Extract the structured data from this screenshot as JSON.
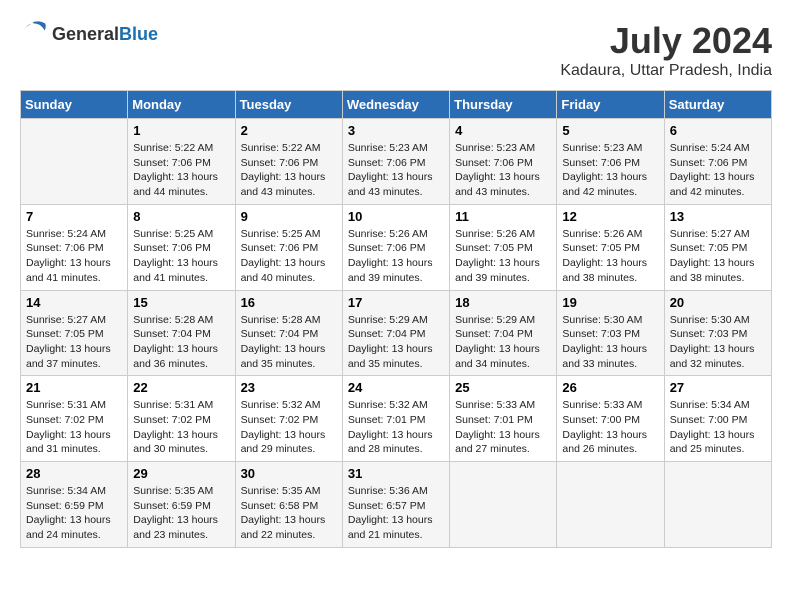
{
  "logo": {
    "text_general": "General",
    "text_blue": "Blue"
  },
  "title": {
    "month_year": "July 2024",
    "location": "Kadaura, Uttar Pradesh, India"
  },
  "days_of_week": [
    "Sunday",
    "Monday",
    "Tuesday",
    "Wednesday",
    "Thursday",
    "Friday",
    "Saturday"
  ],
  "weeks": [
    [
      {
        "day": "",
        "sunrise": "",
        "sunset": "",
        "daylight": ""
      },
      {
        "day": "1",
        "sunrise": "Sunrise: 5:22 AM",
        "sunset": "Sunset: 7:06 PM",
        "daylight": "Daylight: 13 hours and 44 minutes."
      },
      {
        "day": "2",
        "sunrise": "Sunrise: 5:22 AM",
        "sunset": "Sunset: 7:06 PM",
        "daylight": "Daylight: 13 hours and 43 minutes."
      },
      {
        "day": "3",
        "sunrise": "Sunrise: 5:23 AM",
        "sunset": "Sunset: 7:06 PM",
        "daylight": "Daylight: 13 hours and 43 minutes."
      },
      {
        "day": "4",
        "sunrise": "Sunrise: 5:23 AM",
        "sunset": "Sunset: 7:06 PM",
        "daylight": "Daylight: 13 hours and 43 minutes."
      },
      {
        "day": "5",
        "sunrise": "Sunrise: 5:23 AM",
        "sunset": "Sunset: 7:06 PM",
        "daylight": "Daylight: 13 hours and 42 minutes."
      },
      {
        "day": "6",
        "sunrise": "Sunrise: 5:24 AM",
        "sunset": "Sunset: 7:06 PM",
        "daylight": "Daylight: 13 hours and 42 minutes."
      }
    ],
    [
      {
        "day": "7",
        "sunrise": "Sunrise: 5:24 AM",
        "sunset": "Sunset: 7:06 PM",
        "daylight": "Daylight: 13 hours and 41 minutes."
      },
      {
        "day": "8",
        "sunrise": "Sunrise: 5:25 AM",
        "sunset": "Sunset: 7:06 PM",
        "daylight": "Daylight: 13 hours and 41 minutes."
      },
      {
        "day": "9",
        "sunrise": "Sunrise: 5:25 AM",
        "sunset": "Sunset: 7:06 PM",
        "daylight": "Daylight: 13 hours and 40 minutes."
      },
      {
        "day": "10",
        "sunrise": "Sunrise: 5:26 AM",
        "sunset": "Sunset: 7:06 PM",
        "daylight": "Daylight: 13 hours and 39 minutes."
      },
      {
        "day": "11",
        "sunrise": "Sunrise: 5:26 AM",
        "sunset": "Sunset: 7:05 PM",
        "daylight": "Daylight: 13 hours and 39 minutes."
      },
      {
        "day": "12",
        "sunrise": "Sunrise: 5:26 AM",
        "sunset": "Sunset: 7:05 PM",
        "daylight": "Daylight: 13 hours and 38 minutes."
      },
      {
        "day": "13",
        "sunrise": "Sunrise: 5:27 AM",
        "sunset": "Sunset: 7:05 PM",
        "daylight": "Daylight: 13 hours and 38 minutes."
      }
    ],
    [
      {
        "day": "14",
        "sunrise": "Sunrise: 5:27 AM",
        "sunset": "Sunset: 7:05 PM",
        "daylight": "Daylight: 13 hours and 37 minutes."
      },
      {
        "day": "15",
        "sunrise": "Sunrise: 5:28 AM",
        "sunset": "Sunset: 7:04 PM",
        "daylight": "Daylight: 13 hours and 36 minutes."
      },
      {
        "day": "16",
        "sunrise": "Sunrise: 5:28 AM",
        "sunset": "Sunset: 7:04 PM",
        "daylight": "Daylight: 13 hours and 35 minutes."
      },
      {
        "day": "17",
        "sunrise": "Sunrise: 5:29 AM",
        "sunset": "Sunset: 7:04 PM",
        "daylight": "Daylight: 13 hours and 35 minutes."
      },
      {
        "day": "18",
        "sunrise": "Sunrise: 5:29 AM",
        "sunset": "Sunset: 7:04 PM",
        "daylight": "Daylight: 13 hours and 34 minutes."
      },
      {
        "day": "19",
        "sunrise": "Sunrise: 5:30 AM",
        "sunset": "Sunset: 7:03 PM",
        "daylight": "Daylight: 13 hours and 33 minutes."
      },
      {
        "day": "20",
        "sunrise": "Sunrise: 5:30 AM",
        "sunset": "Sunset: 7:03 PM",
        "daylight": "Daylight: 13 hours and 32 minutes."
      }
    ],
    [
      {
        "day": "21",
        "sunrise": "Sunrise: 5:31 AM",
        "sunset": "Sunset: 7:02 PM",
        "daylight": "Daylight: 13 hours and 31 minutes."
      },
      {
        "day": "22",
        "sunrise": "Sunrise: 5:31 AM",
        "sunset": "Sunset: 7:02 PM",
        "daylight": "Daylight: 13 hours and 30 minutes."
      },
      {
        "day": "23",
        "sunrise": "Sunrise: 5:32 AM",
        "sunset": "Sunset: 7:02 PM",
        "daylight": "Daylight: 13 hours and 29 minutes."
      },
      {
        "day": "24",
        "sunrise": "Sunrise: 5:32 AM",
        "sunset": "Sunset: 7:01 PM",
        "daylight": "Daylight: 13 hours and 28 minutes."
      },
      {
        "day": "25",
        "sunrise": "Sunrise: 5:33 AM",
        "sunset": "Sunset: 7:01 PM",
        "daylight": "Daylight: 13 hours and 27 minutes."
      },
      {
        "day": "26",
        "sunrise": "Sunrise: 5:33 AM",
        "sunset": "Sunset: 7:00 PM",
        "daylight": "Daylight: 13 hours and 26 minutes."
      },
      {
        "day": "27",
        "sunrise": "Sunrise: 5:34 AM",
        "sunset": "Sunset: 7:00 PM",
        "daylight": "Daylight: 13 hours and 25 minutes."
      }
    ],
    [
      {
        "day": "28",
        "sunrise": "Sunrise: 5:34 AM",
        "sunset": "Sunset: 6:59 PM",
        "daylight": "Daylight: 13 hours and 24 minutes."
      },
      {
        "day": "29",
        "sunrise": "Sunrise: 5:35 AM",
        "sunset": "Sunset: 6:59 PM",
        "daylight": "Daylight: 13 hours and 23 minutes."
      },
      {
        "day": "30",
        "sunrise": "Sunrise: 5:35 AM",
        "sunset": "Sunset: 6:58 PM",
        "daylight": "Daylight: 13 hours and 22 minutes."
      },
      {
        "day": "31",
        "sunrise": "Sunrise: 5:36 AM",
        "sunset": "Sunset: 6:57 PM",
        "daylight": "Daylight: 13 hours and 21 minutes."
      },
      {
        "day": "",
        "sunrise": "",
        "sunset": "",
        "daylight": ""
      },
      {
        "day": "",
        "sunrise": "",
        "sunset": "",
        "daylight": ""
      },
      {
        "day": "",
        "sunrise": "",
        "sunset": "",
        "daylight": ""
      }
    ]
  ]
}
